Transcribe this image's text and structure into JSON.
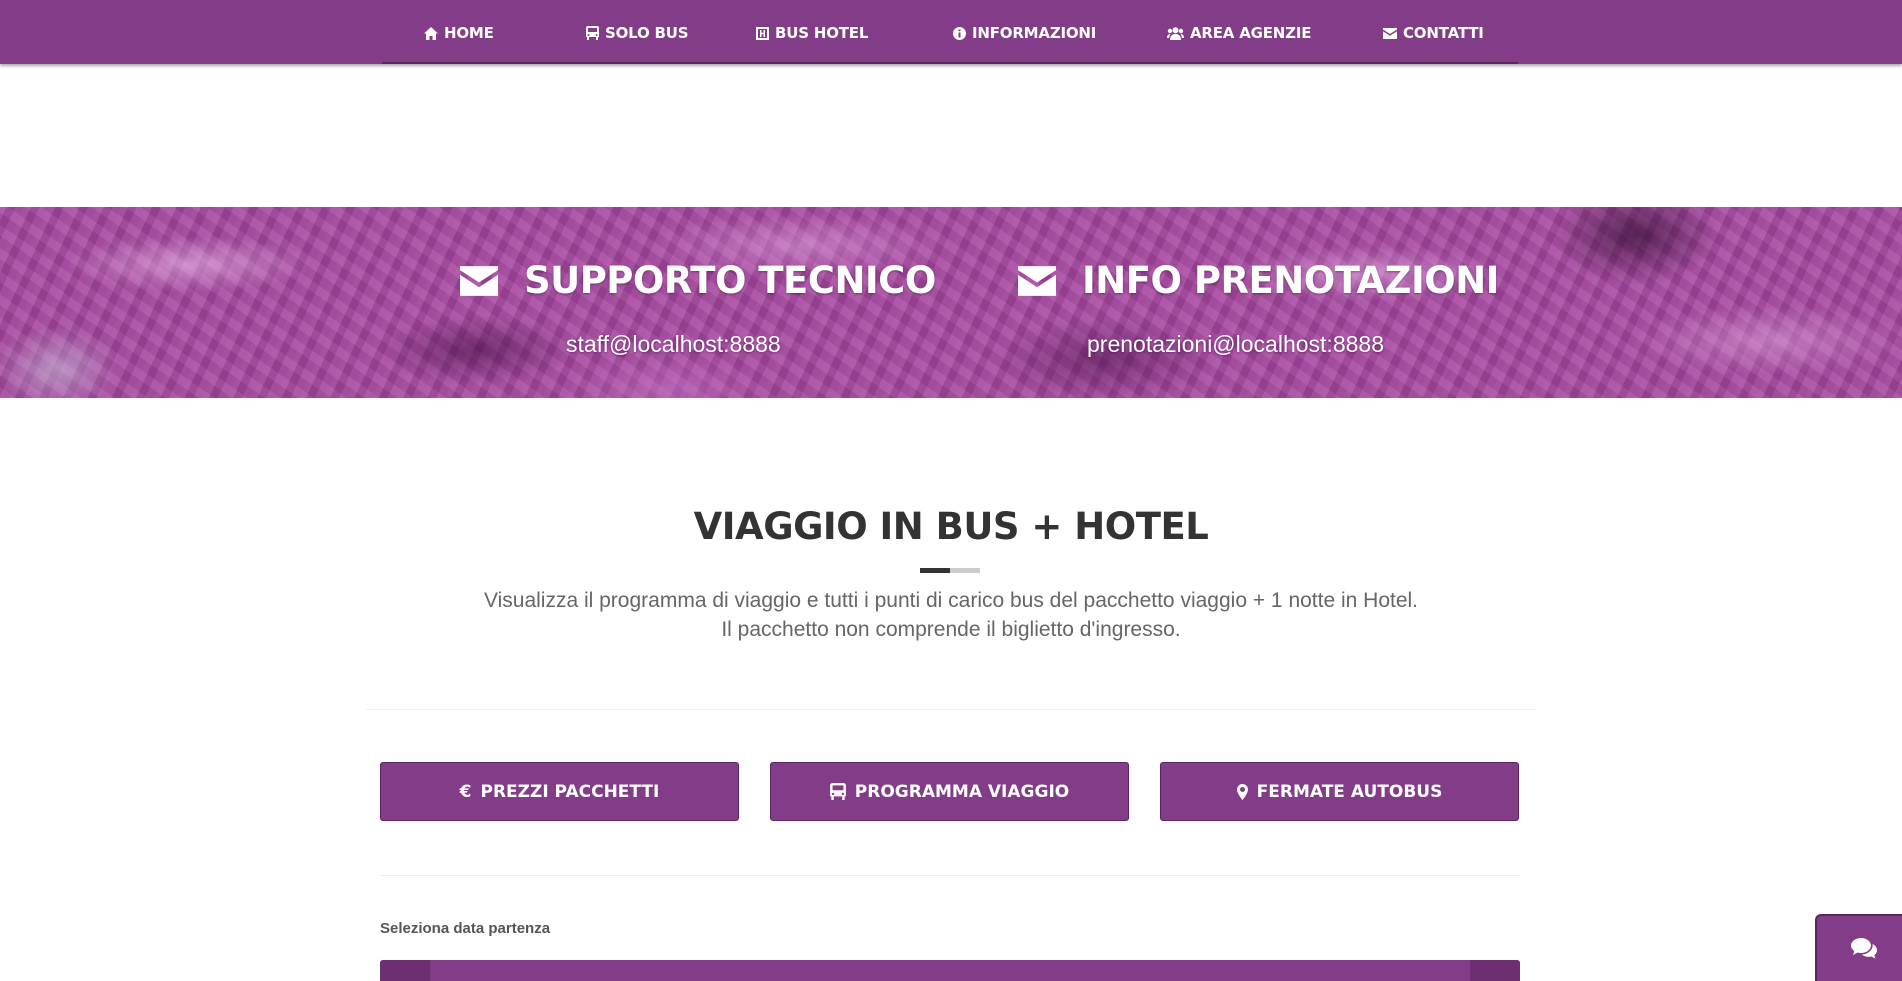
{
  "colors": {
    "brand_purple": "#833c87",
    "brand_purple_dark": "#5a2560",
    "heading_text": "#333333",
    "body_text": "#666666"
  },
  "nav": {
    "items": [
      {
        "label": "HOME",
        "icon": "home-icon"
      },
      {
        "label": "SOLO BUS",
        "icon": "bus-icon"
      },
      {
        "label": "BUS HOTEL",
        "icon": "hotel-icon"
      },
      {
        "label": "INFORMAZIONI",
        "icon": "info-icon"
      },
      {
        "label": "AREA AGENZIE",
        "icon": "users-icon"
      },
      {
        "label": "CONTATTI",
        "icon": "envelope-icon"
      }
    ]
  },
  "contact_band": {
    "support": {
      "title": "SUPPORTO TECNICO",
      "email": "staff@localhost:8888",
      "icon": "envelope-icon"
    },
    "bookings": {
      "title": "INFO PRENOTAZIONI",
      "email": "prenotazioni@localhost:8888",
      "icon": "envelope-icon"
    }
  },
  "section": {
    "title": "VIAGGIO IN BUS + HOTEL",
    "description_line1": "Visualizza il programma di viaggio e tutti i punti di carico bus del pacchetto viaggio + 1 notte in Hotel.",
    "description_line2": "Il pacchetto non comprende il biglietto d'ingresso."
  },
  "buttons": [
    {
      "label": "PREZZI PACCHETTI",
      "icon": "euro-icon"
    },
    {
      "label": "PROGRAMMA VIAGGIO",
      "icon": "bus-icon"
    },
    {
      "label": "FERMATE AUTOBUS",
      "icon": "map-marker-icon"
    }
  ],
  "date_picker": {
    "label": "Seleziona data partenza"
  },
  "chat": {
    "icon": "chat-icon"
  }
}
